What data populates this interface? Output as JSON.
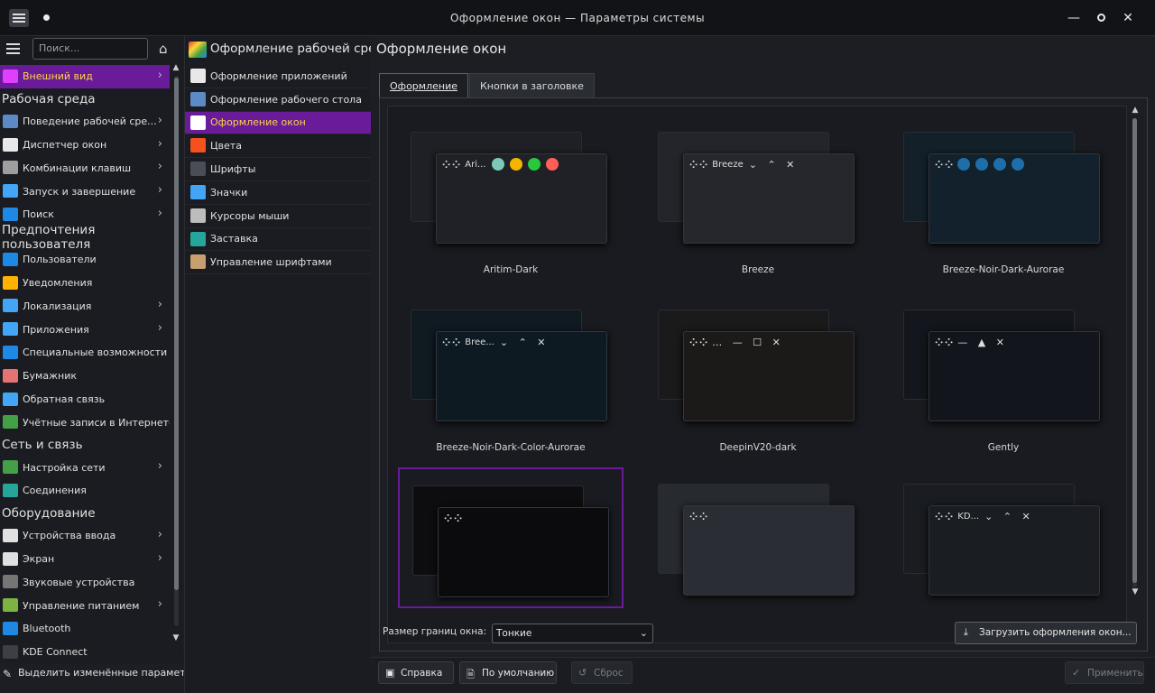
{
  "window": {
    "title": "Оформление окон — Параметры системы"
  },
  "sidebar": {
    "search_placeholder": "Поиск...",
    "items": [
      {
        "type": "item",
        "label": "Внешний вид",
        "active": true,
        "chevron": true,
        "icon": "appearance-icon",
        "color": "#e040fb"
      },
      {
        "type": "head",
        "label": "Рабочая среда"
      },
      {
        "type": "item",
        "label": "Поведение рабочей сре...",
        "chevron": true,
        "icon": "workspace-behavior-icon",
        "color": "#5c8ac7"
      },
      {
        "type": "item",
        "label": "Диспетчер окон",
        "chevron": true,
        "icon": "window-manager-icon",
        "color": "#e8e8e8"
      },
      {
        "type": "item",
        "label": "Комбинации клавиш",
        "chevron": true,
        "icon": "keyboard-icon",
        "color": "#9e9e9e"
      },
      {
        "type": "item",
        "label": "Запуск и завершение",
        "chevron": true,
        "icon": "startup-icon",
        "color": "#42a5f5"
      },
      {
        "type": "item",
        "label": "Поиск",
        "chevron": true,
        "icon": "search-icon",
        "color": "#1e88e5"
      },
      {
        "type": "head",
        "label": "Предпочтения пользователя"
      },
      {
        "type": "item",
        "label": "Пользователи",
        "icon": "users-icon",
        "color": "#1e88e5"
      },
      {
        "type": "item",
        "label": "Уведомления",
        "icon": "bell-icon",
        "color": "#ffb300"
      },
      {
        "type": "item",
        "label": "Локализация",
        "chevron": true,
        "icon": "locale-icon",
        "color": "#42a5f5"
      },
      {
        "type": "item",
        "label": "Приложения",
        "chevron": true,
        "icon": "apps-icon",
        "color": "#42a5f5"
      },
      {
        "type": "item",
        "label": "Специальные возможности",
        "icon": "accessibility-icon",
        "color": "#1e88e5"
      },
      {
        "type": "item",
        "label": "Бумажник",
        "icon": "wallet-icon",
        "color": "#e57373"
      },
      {
        "type": "item",
        "label": "Обратная связь",
        "icon": "feedback-icon",
        "color": "#42a5f5"
      },
      {
        "type": "item",
        "label": "Учётные записи в Интернете",
        "icon": "globe-icon",
        "color": "#43a047"
      },
      {
        "type": "head",
        "label": "Сеть и связь"
      },
      {
        "type": "item",
        "label": "Настройка сети",
        "chevron": true,
        "icon": "network-globe-icon",
        "color": "#43a047"
      },
      {
        "type": "item",
        "label": "Соединения",
        "icon": "connections-icon",
        "color": "#26a69a"
      },
      {
        "type": "head",
        "label": "Оборудование"
      },
      {
        "type": "item",
        "label": "Устройства ввода",
        "chevron": true,
        "icon": "input-devices-icon",
        "color": "#e0e0e0"
      },
      {
        "type": "item",
        "label": "Экран",
        "chevron": true,
        "icon": "display-icon",
        "color": "#e0e0e0"
      },
      {
        "type": "item",
        "label": "Звуковые устройства",
        "icon": "speaker-icon",
        "color": "#757575"
      },
      {
        "type": "item",
        "label": "Управление питанием",
        "chevron": true,
        "icon": "power-icon",
        "color": "#7cb342"
      },
      {
        "type": "item",
        "label": "Bluetooth",
        "icon": "bluetooth-icon",
        "color": "#1e88e5"
      },
      {
        "type": "item",
        "label": "KDE Connect",
        "icon": "kdeconnect-icon",
        "color": "#3c3f45"
      }
    ],
    "highlight_label": "Выделить изменённые параметры"
  },
  "middle": {
    "header": "Оформление рабочей среды",
    "items": [
      {
        "label": "Оформление приложений",
        "icon": "app-style-icon",
        "color": "#e8e8e8"
      },
      {
        "label": "Оформление рабочего стола",
        "icon": "plasma-style-icon",
        "color": "#5c8ac7"
      },
      {
        "label": "Оформление окон",
        "active": true,
        "icon": "window-deco-icon",
        "color": "#ffffff"
      },
      {
        "label": "Цвета",
        "icon": "colors-icon",
        "color": "#f4511e"
      },
      {
        "label": "Шрифты",
        "icon": "fonts-icon",
        "color": "#4a4d55"
      },
      {
        "label": "Значки",
        "icon": "icons-icon",
        "color": "#42a5f5"
      },
      {
        "label": "Курсоры мыши",
        "icon": "cursor-icon",
        "color": "#bdbdbd"
      },
      {
        "label": "Заставка",
        "icon": "splash-icon",
        "color": "#26a69a"
      },
      {
        "label": "Управление шрифтами",
        "icon": "font-manager-icon",
        "color": "#c8a070"
      }
    ]
  },
  "main": {
    "title": "Оформление окон",
    "tabs": [
      "Оформление",
      "Кнопки в заголовке"
    ],
    "themes": [
      {
        "name": "Aritim-Dark",
        "title": "Ari..."
      },
      {
        "name": "Breeze",
        "title": "Breeze"
      },
      {
        "name": "Breeze-Noir-Dark-Aurorae",
        "title": ""
      },
      {
        "name": "Breeze-Noir-Dark-Color-Aurorae",
        "title": "Bree..."
      },
      {
        "name": "DeepinV20-dark",
        "title": ""
      },
      {
        "name": "Gently",
        "title": ""
      },
      {
        "name": "",
        "title": "",
        "selected": true
      },
      {
        "name": "",
        "title": ""
      },
      {
        "name": "",
        "title": "KD..."
      }
    ],
    "border_label": "Размер границ окна:",
    "border_value": "Тонкие",
    "load_button": "Загрузить оформления окон..."
  },
  "footer": {
    "help": "Справка",
    "defaults": "По умолчанию",
    "reset": "Сброс",
    "apply": "Применить"
  }
}
